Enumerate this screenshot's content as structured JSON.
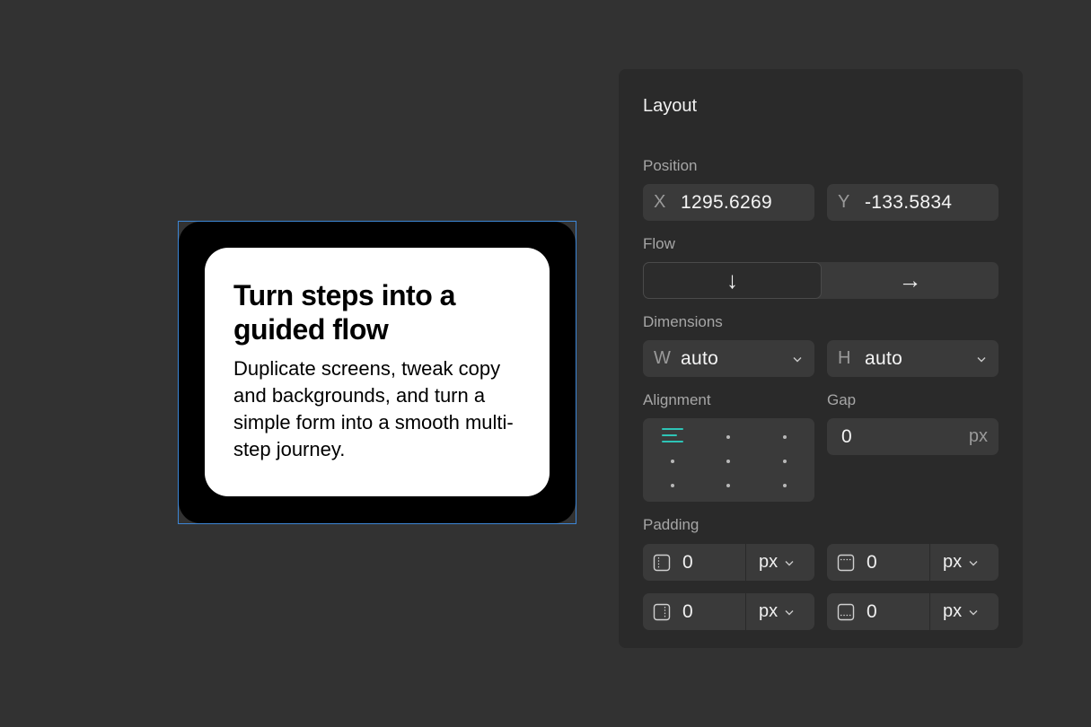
{
  "canvas": {
    "card": {
      "title": "Turn steps into a guided flow",
      "body": "Duplicate screens, tweak copy and backgrounds, and turn a simple form into a smooth multi-step journey."
    }
  },
  "panel": {
    "title": "Layout",
    "position": {
      "label": "Position",
      "x_prefix": "X",
      "x_value": "1295.6269",
      "y_prefix": "Y",
      "y_value": "-133.5834"
    },
    "flow": {
      "label": "Flow",
      "vertical_glyph": "↓",
      "horizontal_glyph": "→",
      "active": "vertical"
    },
    "dimensions": {
      "label": "Dimensions",
      "w_prefix": "W",
      "w_value": "auto",
      "h_prefix": "H",
      "h_value": "auto"
    },
    "alignment": {
      "label": "Alignment",
      "active": "top-left",
      "active_color": "#2ec4b6"
    },
    "gap": {
      "label": "Gap",
      "value": "0",
      "unit": "px"
    },
    "padding": {
      "label": "Padding",
      "left": {
        "value": "0",
        "unit": "px",
        "icon": "padding-left-icon"
      },
      "top": {
        "value": "0",
        "unit": "px",
        "icon": "padding-top-icon"
      },
      "right": {
        "value": "0",
        "unit": "px",
        "icon": "padding-right-icon"
      },
      "bottom": {
        "value": "0",
        "unit": "px",
        "icon": "padding-bottom-icon"
      }
    }
  },
  "colors": {
    "background": "#323232",
    "panel": "#2a2a2a",
    "field": "#3a3a3a",
    "selection": "#3d86d6",
    "accent": "#2ec4b6"
  }
}
